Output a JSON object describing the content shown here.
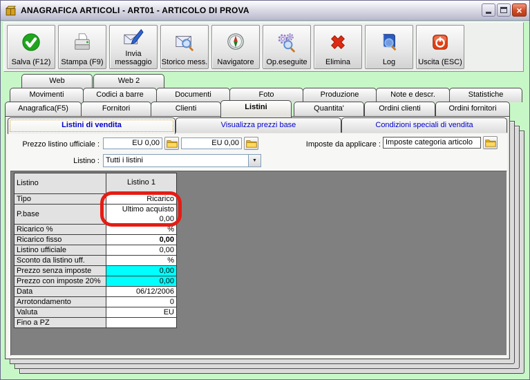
{
  "window": {
    "title": "ANAGRAFICA ARTICOLI - ART01 - ARTICOLO DI PROVA",
    "app_icon": "gold-package-icon",
    "close_glyph": "×"
  },
  "toolbar": {
    "buttons": [
      {
        "label": "Salva (F12)",
        "icon": "save-check-icon"
      },
      {
        "label": "Stampa (F9)",
        "icon": "printer-icon"
      },
      {
        "label": "Invia messaggio",
        "icon": "send-message-icon"
      },
      {
        "label": "Storico mess.",
        "icon": "message-search-icon"
      },
      {
        "label": "Navigatore",
        "icon": "compass-icon"
      },
      {
        "label": "Op.eseguite",
        "icon": "gears-search-icon"
      },
      {
        "label": "Elimina",
        "icon": "red-x-icon"
      },
      {
        "label": "Log",
        "icon": "book-search-icon"
      },
      {
        "label": "Uscita (ESC)",
        "icon": "power-icon"
      }
    ]
  },
  "tabs": {
    "row_top": [
      "Web",
      "Web 2"
    ],
    "row_middle": [
      "Movimenti",
      "Codici a barre",
      "Documenti",
      "Foto",
      "Produzione",
      "Note e descr.",
      "Statistiche"
    ],
    "row_bottom": [
      "Anagrafica(F5)",
      "Fornitori",
      "Clienti",
      "Listini",
      "Quantita'",
      "Ordini clienti",
      "Ordini fornitori"
    ],
    "selected_tab": "Listini",
    "subtabs": [
      "Listini di vendita",
      "Visualizza prezzi base",
      "Condizioni speciali di vendita"
    ],
    "selected_subtab": "Listini di vendita"
  },
  "fields": {
    "prezzo_label": "Prezzo listino ufficiale :",
    "prezzo_value1": "EU 0,00",
    "prezzo_value2": "EU 0,00",
    "imposte_label": "Imposte da applicare :",
    "imposte_value": "Imposte categoria articolo",
    "listino_label": "Listino :",
    "listino_value": "Tutti i listini",
    "combo_arrow": "▼",
    "folder_icon": "folder-icon"
  },
  "grid": {
    "corner_label": "Listino",
    "column_header": "Listino 1",
    "rows": [
      {
        "label": "Tipo",
        "value": "Ricarico"
      },
      {
        "label": "P.base",
        "value_line1": "Ultimo acquisto",
        "value_line2": "0,00"
      },
      {
        "label": "Ricarico %",
        "value": "%"
      },
      {
        "label": "Ricarico fisso",
        "value": "0,00"
      },
      {
        "label": "Listino ufficiale",
        "value": "0,00"
      },
      {
        "label": "Sconto da listino uff.",
        "value": "%"
      },
      {
        "label": "Prezzo senza imposte",
        "value": "0,00"
      },
      {
        "label": "Prezzo con imposte 20%",
        "value": "0,00"
      },
      {
        "label": "Data",
        "value": "06/12/2006"
      },
      {
        "label": "Arrotondamento",
        "value": "0"
      },
      {
        "label": "Valuta",
        "value": "EU"
      },
      {
        "label": "Fino a PZ",
        "value": ""
      }
    ]
  },
  "annotation": {
    "type": "red-rounded-rectangle",
    "color": "#e51c14"
  },
  "colors": {
    "window_background": "#c7f7c7",
    "grid_background": "#808080",
    "highlight_cyan": "#00ffff",
    "subtab_text": "#0000cc",
    "annotation_red": "#e51c14"
  }
}
